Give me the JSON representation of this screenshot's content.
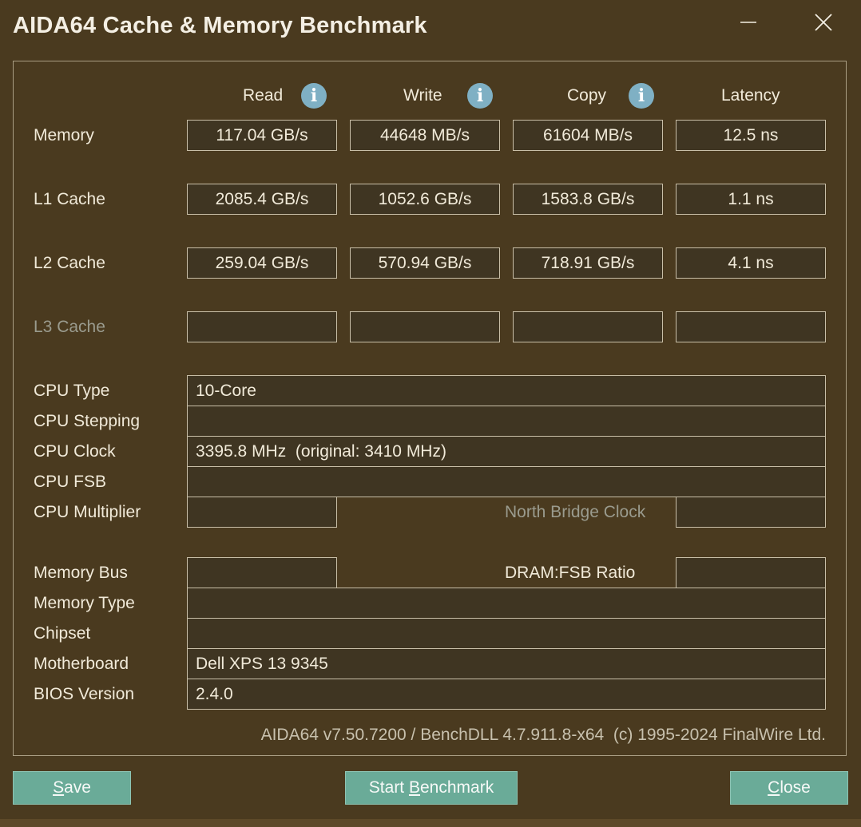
{
  "window": {
    "title": "AIDA64 Cache & Memory Benchmark",
    "minimize_icon": "minimize-icon",
    "close_icon": "close-icon"
  },
  "columns": {
    "read": "Read",
    "write": "Write",
    "copy": "Copy",
    "latency": "Latency",
    "info_icon": "info-icon",
    "info_glyph": "i"
  },
  "rows": {
    "memory": {
      "label": "Memory",
      "read": "117.04 GB/s",
      "write": "44648 MB/s",
      "copy": "61604 MB/s",
      "latency": "12.5 ns"
    },
    "l1": {
      "label": "L1 Cache",
      "read": "2085.4 GB/s",
      "write": "1052.6 GB/s",
      "copy": "1583.8 GB/s",
      "latency": "1.1 ns"
    },
    "l2": {
      "label": "L2 Cache",
      "read": "259.04 GB/s",
      "write": "570.94 GB/s",
      "copy": "718.91 GB/s",
      "latency": "4.1 ns"
    },
    "l3": {
      "label": "L3 Cache",
      "read": "",
      "write": "",
      "copy": "",
      "latency": ""
    }
  },
  "cpu": {
    "type_label": "CPU Type",
    "type_value": "10-Core",
    "stepping_label": "CPU Stepping",
    "stepping_value": "",
    "clock_label": "CPU Clock",
    "clock_value": "3395.8 MHz  (original: 3410 MHz)",
    "fsb_label": "CPU FSB",
    "fsb_value": "",
    "multiplier_label": "CPU Multiplier",
    "multiplier_value": "",
    "nb_clock_label": "North Bridge Clock",
    "nb_clock_value": ""
  },
  "memory_info": {
    "bus_label": "Memory Bus",
    "bus_value": "",
    "ratio_label": "DRAM:FSB Ratio",
    "ratio_value": "",
    "type_label": "Memory Type",
    "type_value": "",
    "chipset_label": "Chipset",
    "chipset_value": "",
    "motherboard_label": "Motherboard",
    "motherboard_value": "Dell XPS 13 9345",
    "bios_label": "BIOS Version",
    "bios_value": "2.4.0"
  },
  "footer": {
    "version": "AIDA64 v7.50.7200 / BenchDLL 4.7.911.8-x64  (c) 1995-2024 FinalWire Ltd."
  },
  "buttons": {
    "save_pre": "",
    "save_key": "S",
    "save_post": "ave",
    "start_pre": "Start ",
    "start_key": "B",
    "start_post": "enchmark",
    "close_pre": "",
    "close_key": "C",
    "close_post": "lose"
  },
  "colors": {
    "background": "#4a3a1f",
    "field": "#3f3522",
    "button": "#6aab98",
    "info_icon": "#7fb0c4",
    "dim_text": "#9a9b8e"
  }
}
